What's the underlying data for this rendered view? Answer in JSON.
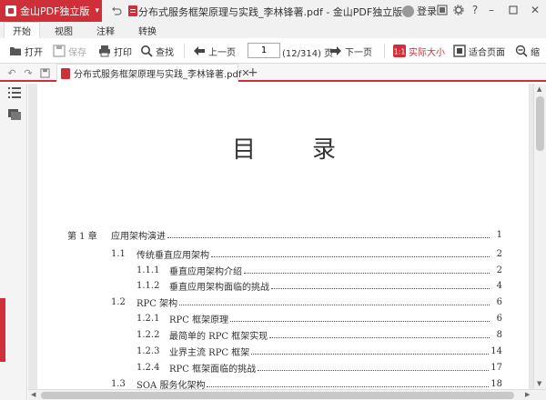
{
  "app": {
    "name": "金山PDF独立版",
    "window_title": "分布式服务框架原理与实践_李林锋著.pdf - 金山PDF独立版",
    "login_label": "登录"
  },
  "menu_tabs": [
    "开始",
    "视图",
    "注释",
    "转换"
  ],
  "toolbar": {
    "open": "打开",
    "save": "保存",
    "print": "打印",
    "find": "查找",
    "prev_page": "上一页",
    "page_input": "1",
    "page_count": "(12/314) 页",
    "next_page": "下一页",
    "actual_size": "实际大小",
    "fit_page": "适合页面",
    "zoom_cut": "缩"
  },
  "doc_tab": {
    "filename": "分布式服务框架原理与实践_李林锋著.pdf"
  },
  "page": {
    "heading": "目录",
    "toc": [
      {
        "num": "第 1 章",
        "title": "应用架构演进",
        "page": "1",
        "level": 0
      },
      {
        "num": "1.1",
        "title": "传统垂直应用架构",
        "page": "2",
        "level": 1
      },
      {
        "num": "1.1.1",
        "title": "垂直应用架构介绍",
        "page": "2",
        "level": 2
      },
      {
        "num": "1.1.2",
        "title": "垂直应用架构面临的挑战",
        "page": "4",
        "level": 2
      },
      {
        "num": "1.2",
        "title": "RPC 架构",
        "page": "6",
        "level": 1
      },
      {
        "num": "1.2.1",
        "title": "RPC 框架原理",
        "page": "6",
        "level": 2
      },
      {
        "num": "1.2.2",
        "title": "最简单的 RPC 框架实现",
        "page": "8",
        "level": 2
      },
      {
        "num": "1.2.3",
        "title": "业界主流 RPC 框架",
        "page": "14",
        "level": 2
      },
      {
        "num": "1.2.4",
        "title": "RPC 框架面临的挑战",
        "page": "17",
        "level": 2
      },
      {
        "num": "1.3",
        "title": "SOA 服务化架构",
        "page": "18",
        "level": 1
      }
    ]
  },
  "colors": {
    "accent": "#cf2f38"
  }
}
